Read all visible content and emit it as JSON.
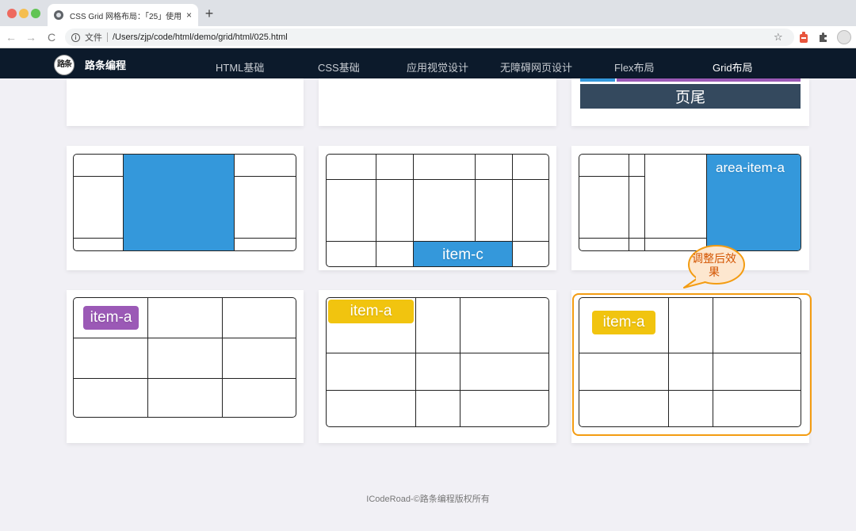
{
  "browser": {
    "tab_title": "CSS Grid 网格布局：「25」使用",
    "tab_close": "×",
    "new_tab": "+",
    "address_label": "文件",
    "url": "/Users/zjp/code/html/demo/grid/html/025.html",
    "back": "←",
    "forward": "→",
    "reload": "C",
    "star": "☆"
  },
  "site": {
    "logo_text": "路条",
    "brand": "路条编程",
    "nav": [
      "HTML基础",
      "CSS基础",
      "应用视觉设计",
      "无障碍网页设计",
      "Flex布局",
      "Grid布局"
    ],
    "active_nav": "Grid布局"
  },
  "demos": {
    "footer_label": "页尾",
    "item_c": "item-c",
    "area_item_a": "area-item-a",
    "item_a_1": "item-a",
    "item_a_2": "item-a",
    "item_a_3": "item-a"
  },
  "annotation": {
    "callout": "调整后效果",
    "highlight_color": "#f39c12"
  },
  "footer": {
    "copyright": "ICodeRoad-©路条编程版权所有"
  },
  "colors": {
    "header_bg": "#0c1a2b",
    "grid_blue": "#3498db",
    "chip_purple": "#9b59b6",
    "chip_yellow": "#f1c40f",
    "footer_bar": "#34495e"
  }
}
